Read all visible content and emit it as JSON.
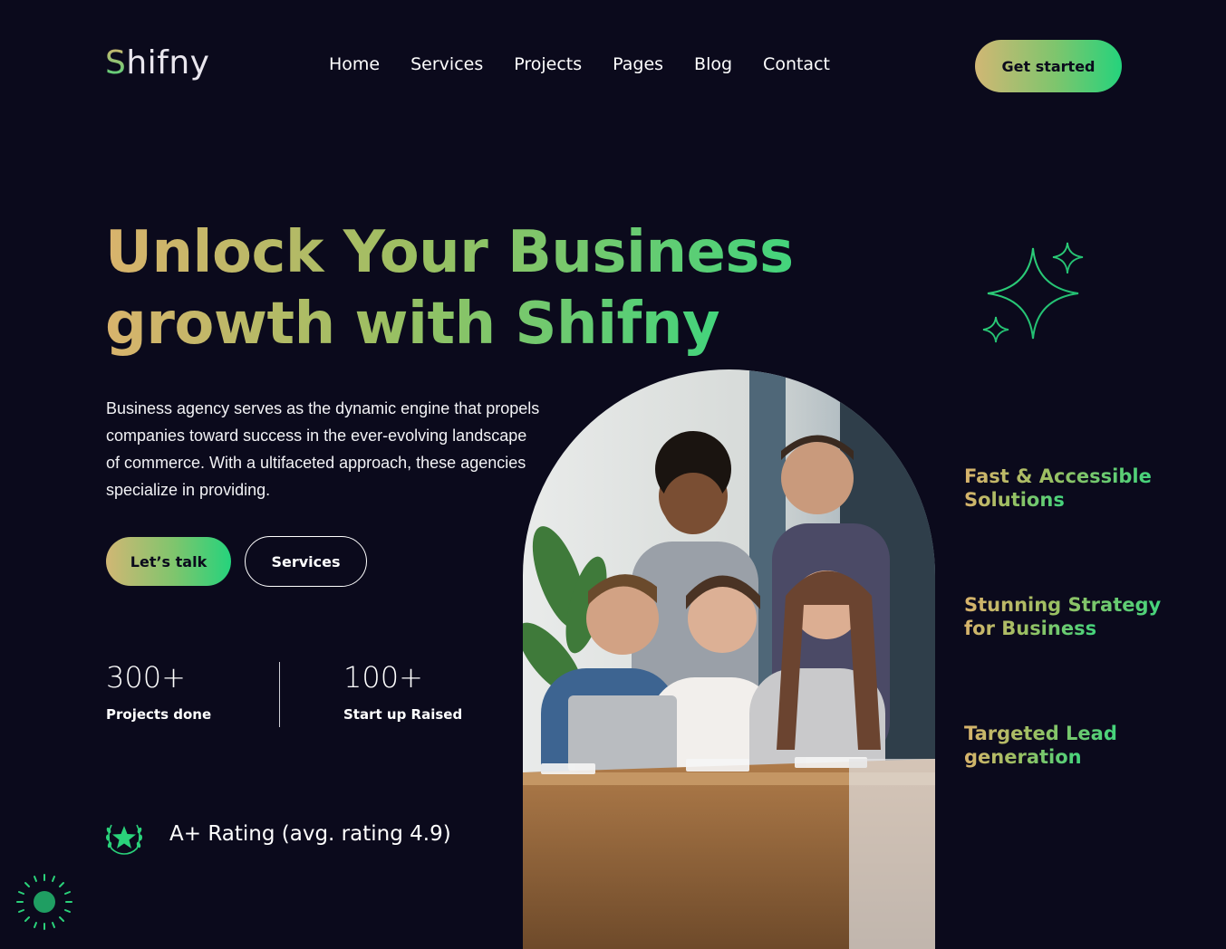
{
  "brand": {
    "logo_first": "S",
    "logo_rest": "hifny"
  },
  "nav": {
    "items": [
      {
        "label": "Home"
      },
      {
        "label": "Services"
      },
      {
        "label": "Projects"
      },
      {
        "label": "Pages"
      },
      {
        "label": "Blog"
      },
      {
        "label": "Contact"
      }
    ],
    "cta_label": "Get started"
  },
  "hero": {
    "title_line1": "Unlock Your Business",
    "title_line2": "growth with Shifny",
    "description": "Business agency serves as the dynamic engine that propels companies toward success in the ever-evolving landscape of commerce. With a ultifaceted approach, these agencies specialize in providing.",
    "primary_button": "Let’s talk",
    "secondary_button": "Services"
  },
  "stats": [
    {
      "value": "300+",
      "label": "Projects done"
    },
    {
      "value": "100+",
      "label": "Start up Raised"
    }
  ],
  "rating": {
    "text": "A+ Rating (avg. rating 4.9)",
    "icon": "laurel-star-icon"
  },
  "features": [
    {
      "line1": "Fast & Accessible",
      "line2": "Solutions"
    },
    {
      "line1": "Stunning Strategy",
      "line2": "for Business"
    },
    {
      "line1": "Targeted Lead",
      "line2": "generation"
    }
  ],
  "colors": {
    "background": "#0b0a1c",
    "gradient_start": "#d9b36c",
    "gradient_end": "#25d37c",
    "accent_green": "#1f9e62"
  }
}
